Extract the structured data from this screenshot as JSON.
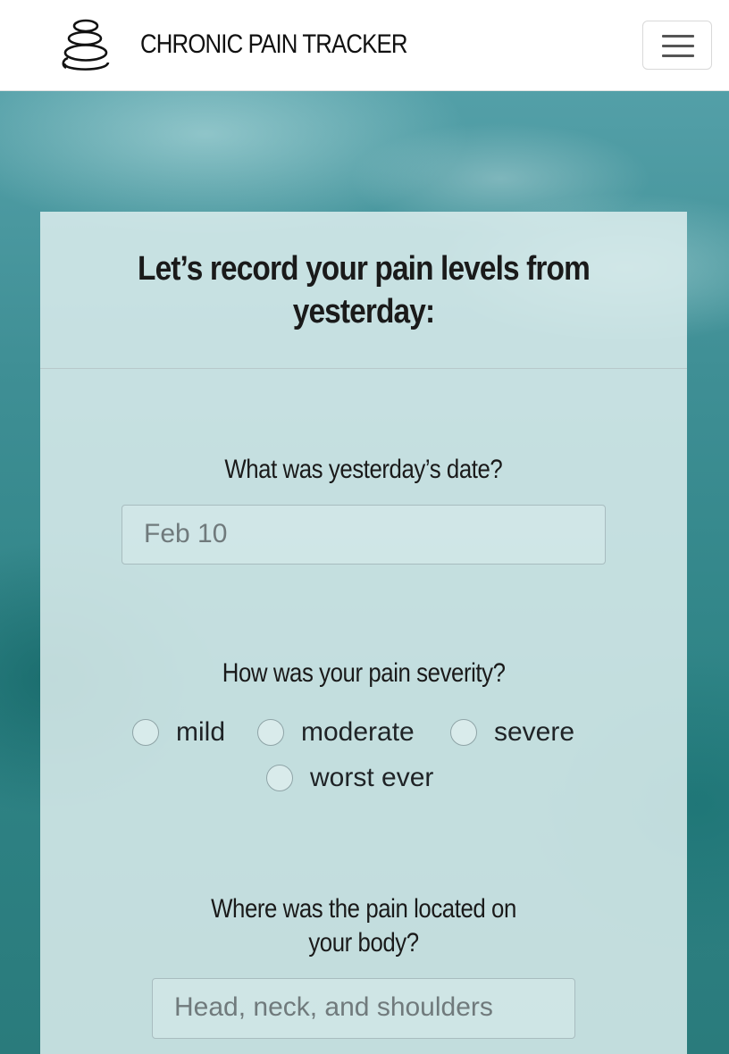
{
  "navbar": {
    "brand": "CHRONIC PAIN TRACKER",
    "logo_icon": "stacked-stones-icon",
    "menu_icon": "hamburger-menu-icon"
  },
  "form": {
    "title": "Let’s record your pain levels from yesterday:",
    "date_question": "What was yesterday’s date?",
    "date_placeholder": "Feb 10",
    "severity_question": "How was your pain severity?",
    "severity_options": [
      "mild",
      "moderate",
      "severe",
      "worst ever"
    ],
    "location_question": "Where was the pain located on your body?",
    "location_placeholder": "Head, neck, and shoulders"
  },
  "colors": {
    "background_accent": "#2f8486",
    "card_overlay": "#e0f0f0",
    "text": "#1a1a1a"
  }
}
